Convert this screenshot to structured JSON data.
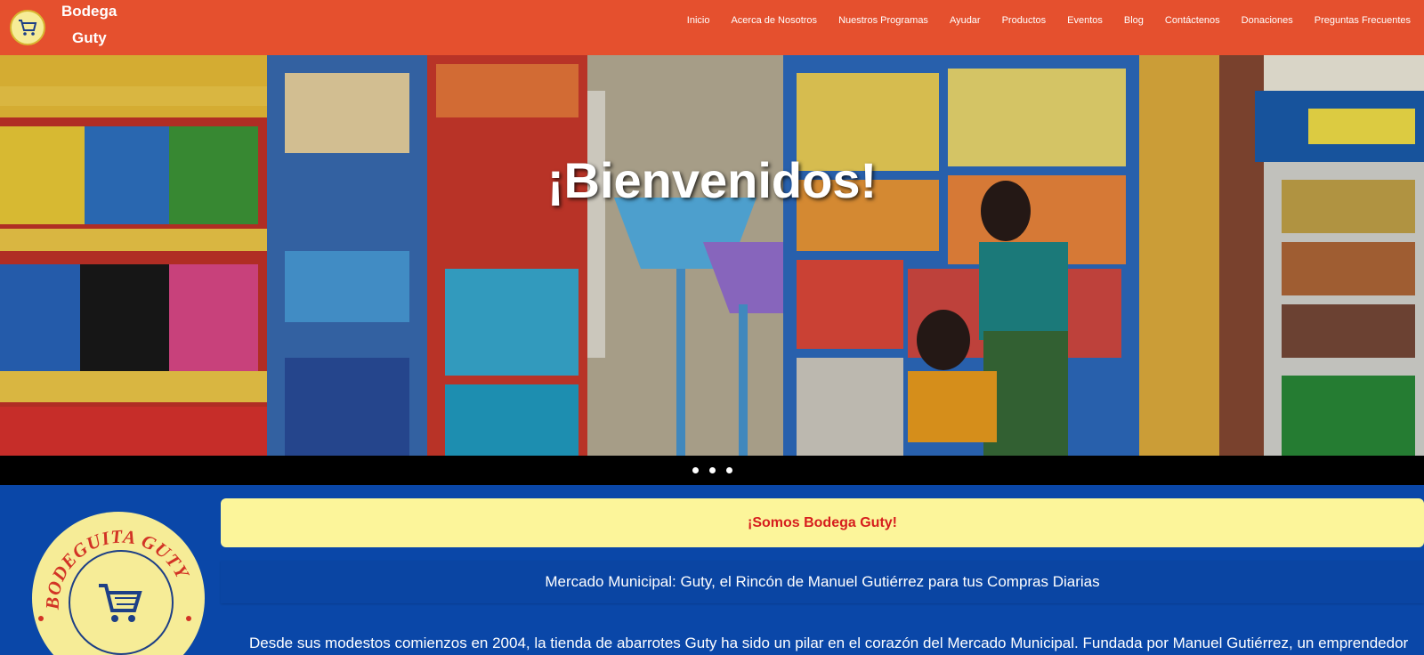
{
  "brand": {
    "name_line1": "Bodega",
    "name_line2": "Guty",
    "logo_text": "BODEGUITA GUTY",
    "logo_icon": "shopping-cart-icon"
  },
  "nav": {
    "links": [
      "Inicio",
      "Acerca de Nosotros",
      "Nuestros Programas",
      "Ayudar",
      "Productos",
      "Eventos",
      "Blog",
      "Contáctenos",
      "Donaciones",
      "Preguntas Frecuentes"
    ]
  },
  "hero": {
    "title": "¡Bienvenidos!",
    "slide_count": 3
  },
  "about": {
    "headline": "¡Somos Bodega Guty!",
    "subtitle": "Mercado Municipal: Guty, el Rincón de Manuel Gutiérrez para tus Compras Diarias",
    "paragraph": "Desde sus modestos comienzos en 2004, la tienda de abarrotes Guty ha sido un pilar en el corazón del Mercado Municipal. Fundada por Manuel Gutiérrez, un emprendedor"
  },
  "colors": {
    "navbar": "#e5502e",
    "section_bg": "#0a47a8",
    "headline_bg": "#fcf59a",
    "headline_text": "#d61e1e",
    "logo_bg": "#f6ec97"
  }
}
